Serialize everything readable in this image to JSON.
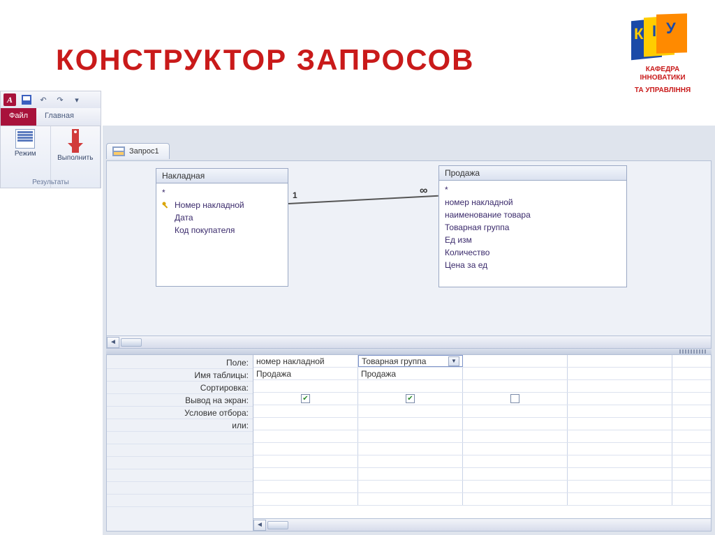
{
  "slide_title": "КОНСТРУКТОР ЗАПРОСОВ",
  "logo": {
    "line1": "КАФЕДРА ІННОВАТИКИ",
    "line2": "ТА УПРАВЛІННЯ"
  },
  "qat": {
    "sep": "|"
  },
  "tabs": {
    "file": "Файл",
    "home": "Главная"
  },
  "ribbon": {
    "mode_label": "Режим",
    "run_label": "Выполнить",
    "group_title": "Результаты"
  },
  "doc_tab": {
    "label": "Запрос1"
  },
  "tables": {
    "left": {
      "title": "Накладная",
      "fields": [
        "*",
        "Номер накладной",
        "Дата",
        "Код покупателя"
      ],
      "key_index": 1
    },
    "right": {
      "title": "Продажа",
      "fields": [
        "*",
        "номер накладной",
        "наименование товара",
        "Товарная группа",
        "Ед изм",
        "Количество",
        "Цена за ед"
      ]
    }
  },
  "relation": {
    "one": "1",
    "many": "∞"
  },
  "grid": {
    "labels": [
      "Поле:",
      "Имя таблицы:",
      "Сортировка:",
      "Вывод на экран:",
      "Условие отбора:",
      "или:"
    ],
    "cols": [
      {
        "field": "номер накладной",
        "table": "Продажа",
        "show": true,
        "selected": false
      },
      {
        "field": "Товарная группа",
        "table": "Продажа",
        "show": true,
        "selected": true
      },
      {
        "field": "",
        "table": "",
        "show": false,
        "selected": false
      },
      {
        "field": "",
        "table": "",
        "show": null,
        "selected": false
      }
    ]
  }
}
